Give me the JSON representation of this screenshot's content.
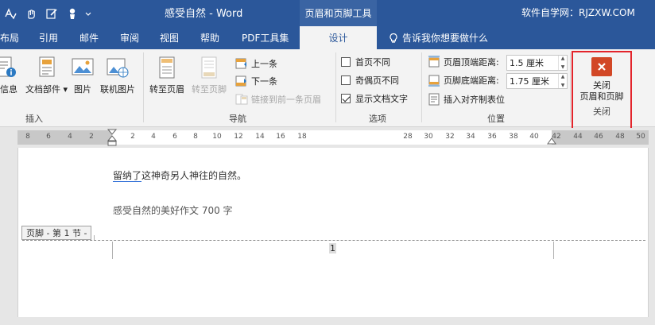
{
  "window": {
    "title": "感受自然 - Word",
    "context_tab_title": "页眉和页脚工具",
    "site_label": "软件自学网：RJZXW.COM"
  },
  "tabs": [
    {
      "label": "布局"
    },
    {
      "label": "引用"
    },
    {
      "label": "邮件"
    },
    {
      "label": "审阅"
    },
    {
      "label": "视图"
    },
    {
      "label": "帮助"
    },
    {
      "label": "PDF工具集"
    },
    {
      "label": "设计"
    }
  ],
  "tell_me": "告诉我你想要做什么",
  "ribbon": {
    "insert_group": {
      "label": "插入",
      "info_btn": "信息",
      "parts_btn": "文档部件",
      "picture_btn": "图片",
      "online_picture_btn": "联机图片"
    },
    "nav_group": {
      "label": "导航",
      "goto_header": "转至页眉",
      "goto_footer": "转至页脚",
      "prev": "上一条",
      "next": "下一条",
      "link_prev": "链接到前一条页眉"
    },
    "options_group": {
      "label": "选项",
      "first_page": "首页不同",
      "odd_even": "奇偶页不同",
      "show_doc_text": "显示文档文字",
      "first_page_checked": false,
      "odd_even_checked": false,
      "show_doc_text_checked": true
    },
    "position_group": {
      "label": "位置",
      "header_top_label": "页眉顶端距离:",
      "header_top_value": "1.5 厘米",
      "footer_bottom_label": "页脚底端距离:",
      "footer_bottom_value": "1.75 厘米",
      "insert_align_tab": "插入对齐制表位"
    },
    "close_group": {
      "label": "关闭",
      "close_btn_line1": "关闭",
      "close_btn_line2": "页眉和页脚"
    }
  },
  "ruler": {
    "ticks": [
      "8",
      "6",
      "4",
      "2",
      "2",
      "4",
      "6",
      "8",
      "10",
      "12",
      "14",
      "16",
      "18",
      "28",
      "30",
      "32",
      "34",
      "36",
      "38",
      "40",
      "42",
      "44",
      "46",
      "48",
      "50"
    ]
  },
  "document": {
    "line1_underlined": "留纳了",
    "line1_rest": "这神奇另人神往的自然。",
    "line2": "感受自然的美好作文 700 字",
    "footer_tag": "页脚 - 第 1 节 -",
    "page_number": "1"
  },
  "colors": {
    "title_bar": "#2b579a",
    "close_highlight": "#e3242b",
    "close_icon": "#d24726"
  }
}
